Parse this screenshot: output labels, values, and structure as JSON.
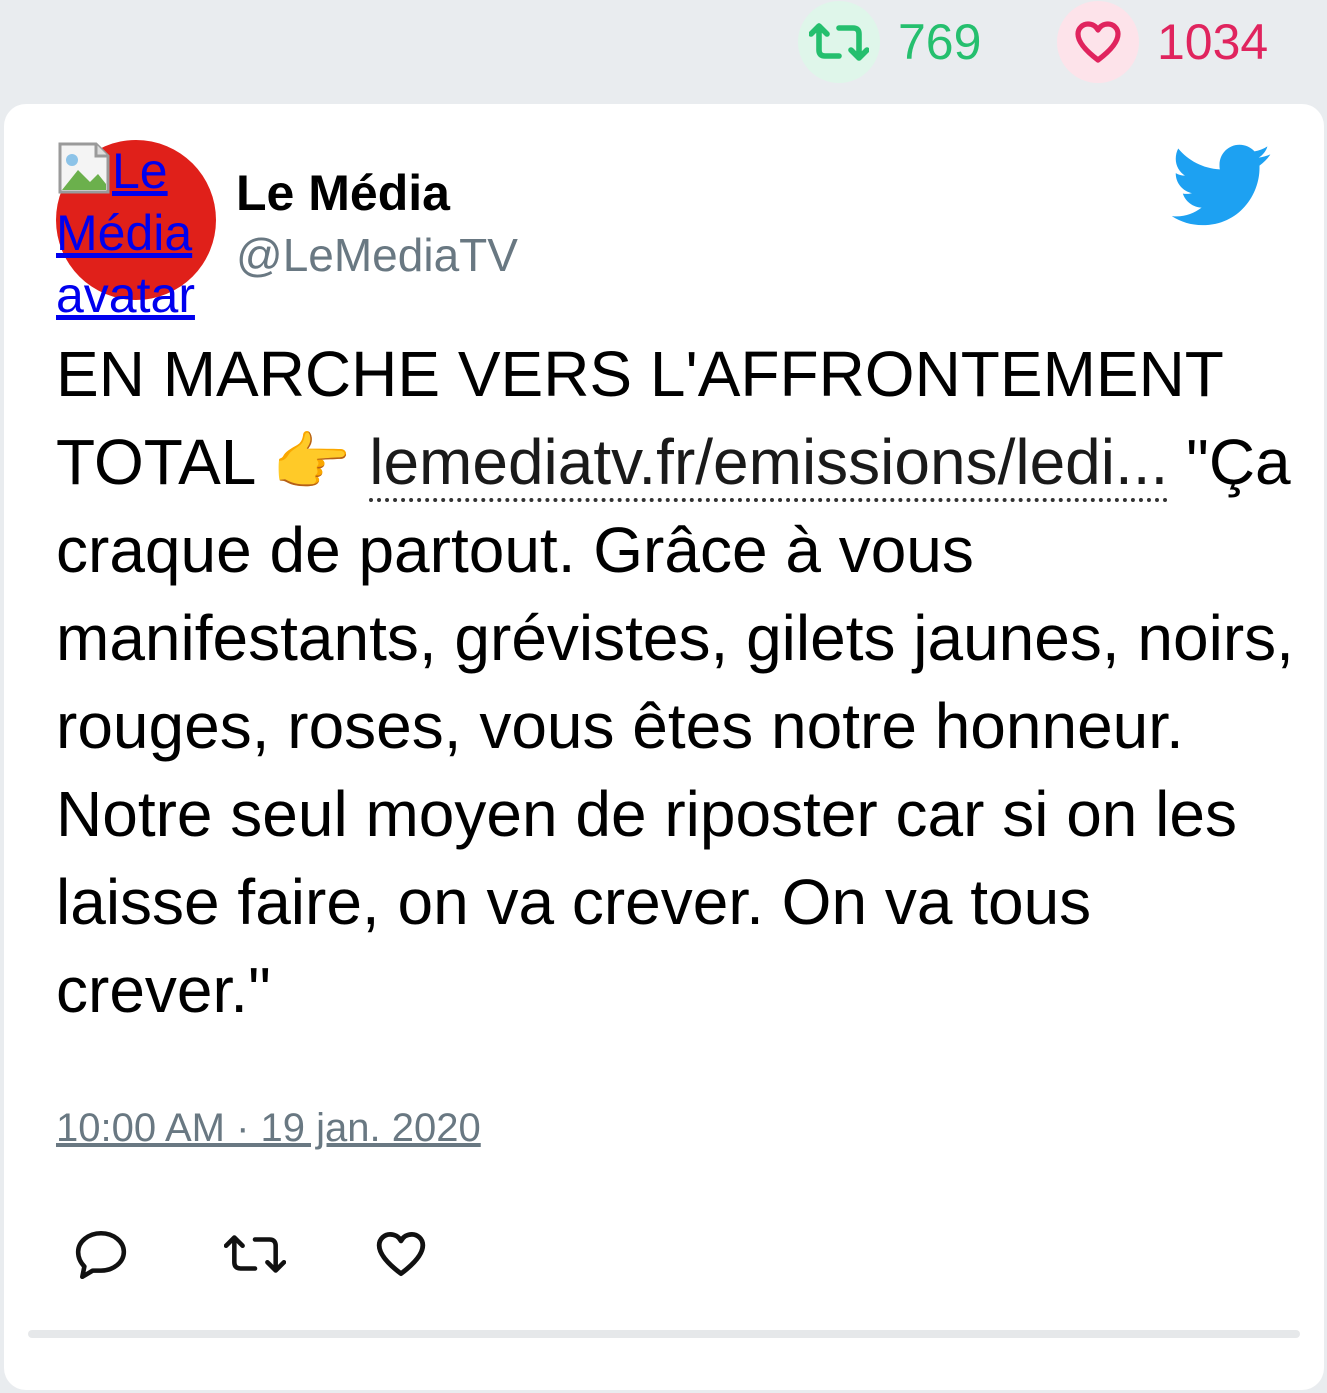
{
  "stats": {
    "retweets_count": "769",
    "likes_count": "1034",
    "retweet_icon": "retweet-icon",
    "like_icon": "heart-icon"
  },
  "tweet": {
    "author_name": "Le Média",
    "author_handle": "@LeMediaTV",
    "avatar_alt": "Le Média avatar",
    "text_part1": "EN MARCHE VERS L'AFFRONTEMENT TOTAL 👉 ",
    "link_text": "lemediatv.fr/emissions/ledi...",
    "text_part2": " \"Ça craque de partout. Grâce à vous manifestants, grévistes, gilets jaunes, noirs, rouges, roses, vous êtes notre honneur. Notre seul moyen de riposter car si on les laisse faire, on va crever. On va tous crever.\"",
    "timestamp": "10:00 AM · 19 jan. 2020"
  },
  "colors": {
    "retweet_green": "#25bf6e",
    "like_red": "#e0245e",
    "twitter_blue": "#1da1f2",
    "muted": "#697882"
  }
}
